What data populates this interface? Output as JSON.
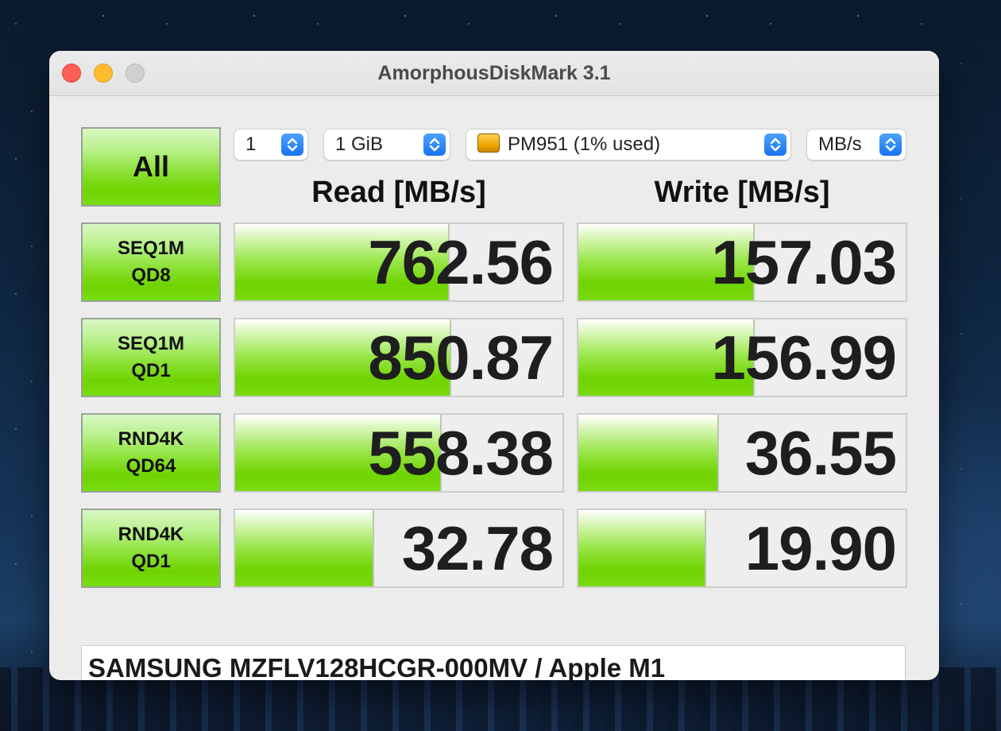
{
  "window": {
    "title": "AmorphousDiskMark 3.1"
  },
  "controls": {
    "count": "1",
    "size": "1 GiB",
    "drive": "PM951 (1% used)",
    "unit": "MB/s"
  },
  "buttons": {
    "all": "All",
    "tests": [
      {
        "line1": "SEQ1M",
        "line2": "QD8"
      },
      {
        "line1": "SEQ1M",
        "line2": "QD1"
      },
      {
        "line1": "RND4K",
        "line2": "QD64"
      },
      {
        "line1": "RND4K",
        "line2": "QD1"
      }
    ]
  },
  "headers": {
    "read": "Read [MB/s]",
    "write": "Write [MB/s]"
  },
  "results": {
    "read": [
      "762.56",
      "850.87",
      "558.38",
      "32.78"
    ],
    "write": [
      "157.03",
      "156.99",
      "36.55",
      "19.90"
    ],
    "read_fill": [
      0.65,
      0.655,
      0.625,
      0.42
    ],
    "write_fill": [
      0.535,
      0.535,
      0.425,
      0.385
    ]
  },
  "comment": "SAMSUNG MZFLV128HCGR-000MV / Apple M1",
  "icons": {
    "close": "close-icon",
    "minimize": "minimize-icon",
    "maximize": "maximize-icon",
    "drive": "drive-icon",
    "stepper": "stepper-icon"
  },
  "colors": {
    "bar_green": "#6fd400",
    "close": "#fe5f57",
    "minimize": "#febc2e",
    "stepper_blue": "#1874f0"
  }
}
